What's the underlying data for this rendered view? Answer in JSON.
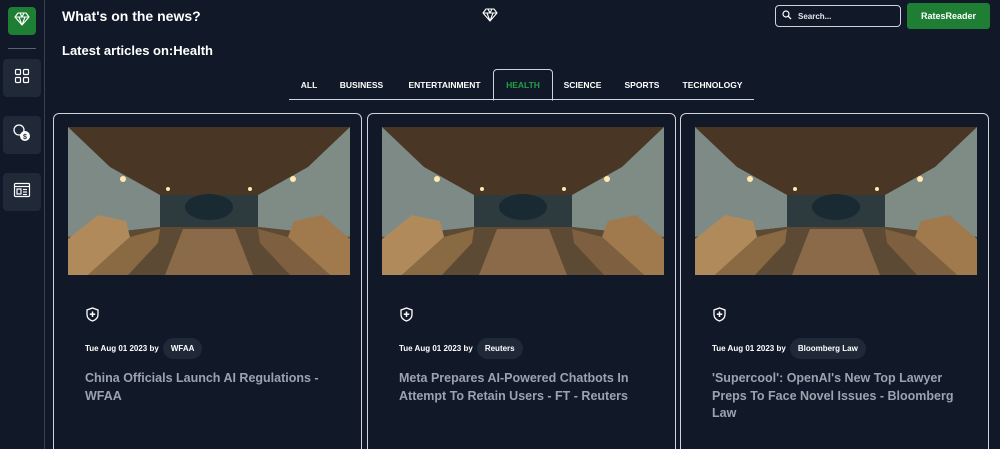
{
  "header": {
    "title": "What's on the news?",
    "search_placeholder": "Search...",
    "rates_button": "RatesReader"
  },
  "section_title": "Latest articles on:Health",
  "tabs": [
    "ALL",
    "BUSINESS",
    "ENTERTAINMENT",
    "HEALTH",
    "SCIENCE",
    "SPORTS",
    "TECHNOLOGY"
  ],
  "active_tab": "HEALTH",
  "sidebar": {
    "icons": [
      "diamond-icon",
      "grid-icon",
      "coins-icon",
      "newspaper-icon"
    ]
  },
  "colors": {
    "accent": "#1e7e34",
    "accent_text": "#22a046",
    "background": "#111827",
    "panel": "#1f2937",
    "headline": "#9ca3af"
  },
  "articles": [
    {
      "date": "Tue Aug 01 2023",
      "by": "by",
      "source": "WFAA",
      "title": "China Officials Launch AI Regulations - WFAA"
    },
    {
      "date": "Tue Aug 01 2023",
      "by": "by",
      "source": "Reuters",
      "title": "Meta Prepares AI-Powered Chatbots In Attempt To Retain Users - FT - Reuters"
    },
    {
      "date": "Tue Aug 01 2023",
      "by": "by",
      "source": "Bloomberg Law",
      "title": "'Supercool': OpenAI's New Top Lawyer Preps To Face Novel Issues - Bloomberg Law"
    }
  ]
}
